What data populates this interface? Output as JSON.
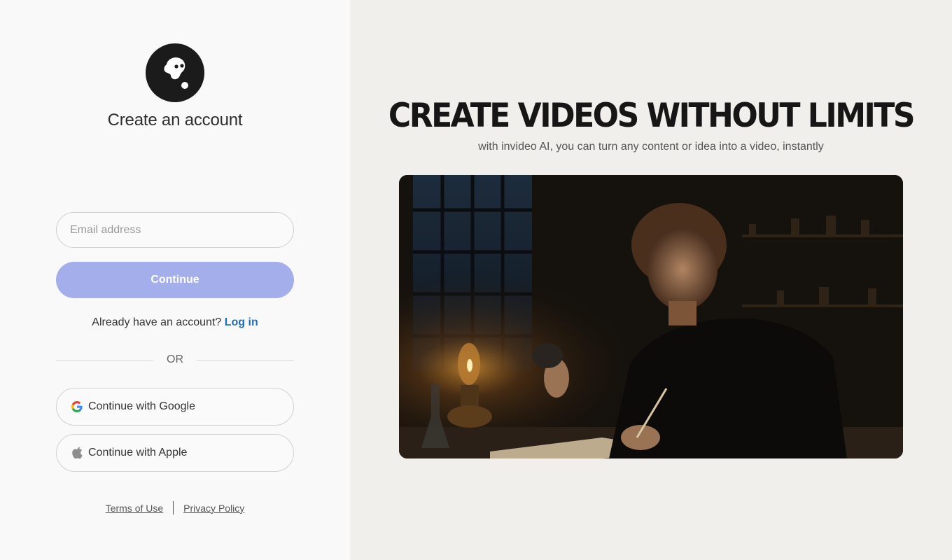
{
  "left": {
    "heading": "Create an account",
    "email": {
      "placeholder": "Email address",
      "value": ""
    },
    "continue_label": "Continue",
    "already_text": "Already have an account?",
    "login_label": "Log in",
    "or_label": "OR",
    "google_label": "Continue with Google",
    "apple_label": "Continue with Apple",
    "terms_label": "Terms of Use",
    "privacy_label": "Privacy Policy"
  },
  "right": {
    "title": "CREATE VIDEOS WITHOUT LIMITS",
    "subtitle": "with invideo AI, you can turn any content or idea into a video, instantly"
  },
  "icons": {
    "logo": "invideo-logo-icon",
    "google": "google-icon",
    "apple": "apple-icon"
  },
  "colors": {
    "accent_button": "#a3aeea",
    "link": "#1f6fb8",
    "left_bg": "#f9f9f9",
    "right_bg": "#f1efeb"
  }
}
